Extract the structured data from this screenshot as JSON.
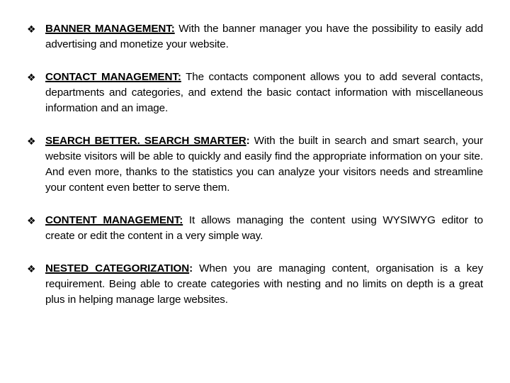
{
  "slide": {
    "background_color": "#ffffff",
    "text_color": "#000000",
    "bullet_glyph": "❖",
    "bullet_icon_name": "diamond-bullet-icon"
  },
  "bullets": [
    {
      "id": "banner-management",
      "bullet": "❖",
      "lead": "BANNER MANAGEMENT:",
      "lead_underlined": true,
      "colon_underlined": true,
      "body": " With the banner manager you have the possibility to easily add advertising and monetize your website."
    },
    {
      "id": "contact-management",
      "bullet": "❖",
      "lead": "CONTACT  MANAGEMENT:",
      "lead_underlined": true,
      "colon_underlined": true,
      "body": " The contacts component allows you to add several contacts, departments and categories, and extend the basic contact information with miscellaneous information and an image."
    },
    {
      "id": "search-better-search-smarter",
      "bullet": "❖",
      "lead": "SEARCH BETTER. SEARCH SMARTER",
      "lead_underlined": true,
      "colon_underlined": false,
      "colon": ":",
      "body": " With the built in search and smart search, your website visitors will be able to quickly and easily find the appropriate information on your site. And even more, thanks to the statistics you can analyze your visitors needs and streamline your content even better to serve them."
    },
    {
      "id": "content-management",
      "bullet": "❖",
      "lead": " CONTENT MANAGEMENT:",
      "lead_underlined": true,
      "colon_underlined": true,
      "body": " It allows managing the content using WYSIWYG editor to create or edit the content in a very simple way."
    },
    {
      "id": "nested-categorization",
      "bullet": "❖",
      "lead": "NESTED CATEGORIZATION",
      "lead_underlined": true,
      "colon_underlined": false,
      "colon": ":",
      "body": " When you are managing content, organisation is a key requirement. Being able to create categories with nesting and no limits on depth is a great plus in helping manage large websites."
    }
  ]
}
